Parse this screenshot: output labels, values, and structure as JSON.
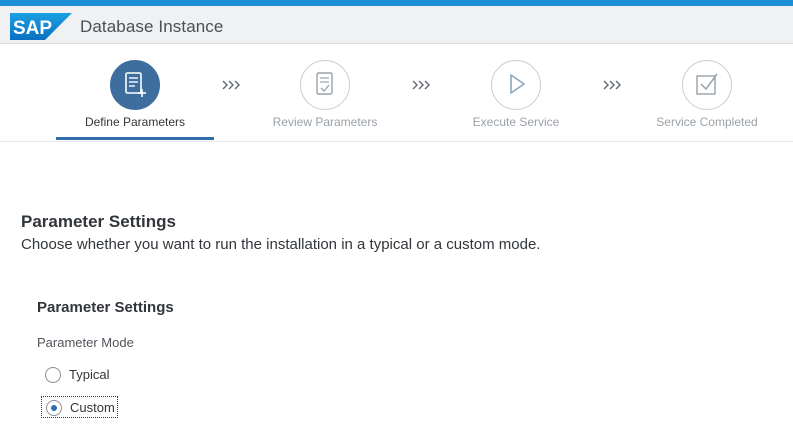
{
  "header": {
    "logo_text": "SAP",
    "title": "Database Instance"
  },
  "wizard": {
    "steps": [
      {
        "label": "Define Parameters",
        "icon": "document-add-icon",
        "active": true
      },
      {
        "label": "Review Parameters",
        "icon": "document-check-icon",
        "active": false
      },
      {
        "label": "Execute Service",
        "icon": "play-icon",
        "active": false
      },
      {
        "label": "Service Completed",
        "icon": "checkbox-icon",
        "active": false
      }
    ],
    "separator_icon": "chevron-triple-right-icon"
  },
  "main": {
    "section_title": "Parameter Settings",
    "section_description": "Choose whether you want to run the installation in a typical or a custom mode.",
    "group_title": "Parameter Settings",
    "field_label": "Parameter Mode",
    "options": [
      {
        "label": "Typical",
        "selected": false
      },
      {
        "label": "Custom",
        "selected": true
      }
    ]
  },
  "colors": {
    "accent": "#3e6e9e",
    "top_bar": "#1d8fd6",
    "header_bg": "#eff1f2",
    "sap_blue": "#1a8fd6"
  }
}
